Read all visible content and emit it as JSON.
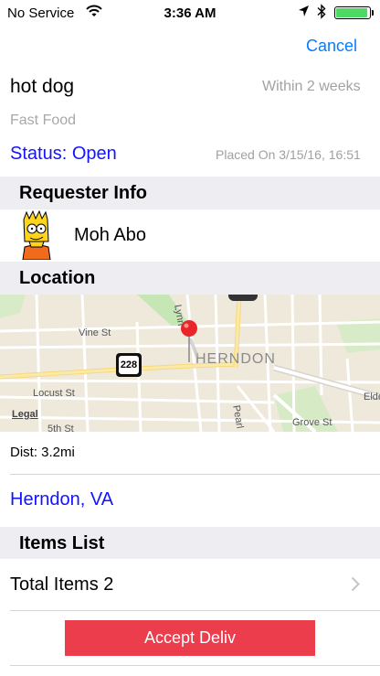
{
  "status_bar": {
    "carrier": "No Service",
    "time": "3:36 AM",
    "wifi_icon": "wifi-icon",
    "location_icon": "location-arrow-icon",
    "bluetooth_icon": "bluetooth-icon",
    "battery_color": "#4cd964",
    "battery_level": 0.95
  },
  "nav": {
    "cancel_label": "Cancel"
  },
  "order": {
    "title": "hot dog",
    "deadline": "Within 2 weeks",
    "category": "Fast Food",
    "status": "Status: Open",
    "placed_on": "Placed On 3/15/16, 16:51"
  },
  "requester": {
    "section_title": "Requester Info",
    "name": "Moh Abo"
  },
  "location": {
    "section_title": "Location",
    "map": {
      "streets": [
        "Vine St",
        "Locust St",
        "5th St",
        "Grove St",
        "Elden",
        "Lynn",
        "Pearl"
      ],
      "town_label": "HERNDON",
      "route_shield": "228",
      "legal": "Legal"
    },
    "distance": "Dist: 3.2mi",
    "city": "Herndon, VA"
  },
  "items": {
    "section_title": "Items List",
    "total": "Total Items 2"
  },
  "actions": {
    "accept_label": "Accept Deliv"
  },
  "colors": {
    "link_blue": "#0a7aff",
    "status_blue": "#1313ff",
    "accept_red": "#ec3d4c",
    "section_bg": "#eeeef2"
  }
}
